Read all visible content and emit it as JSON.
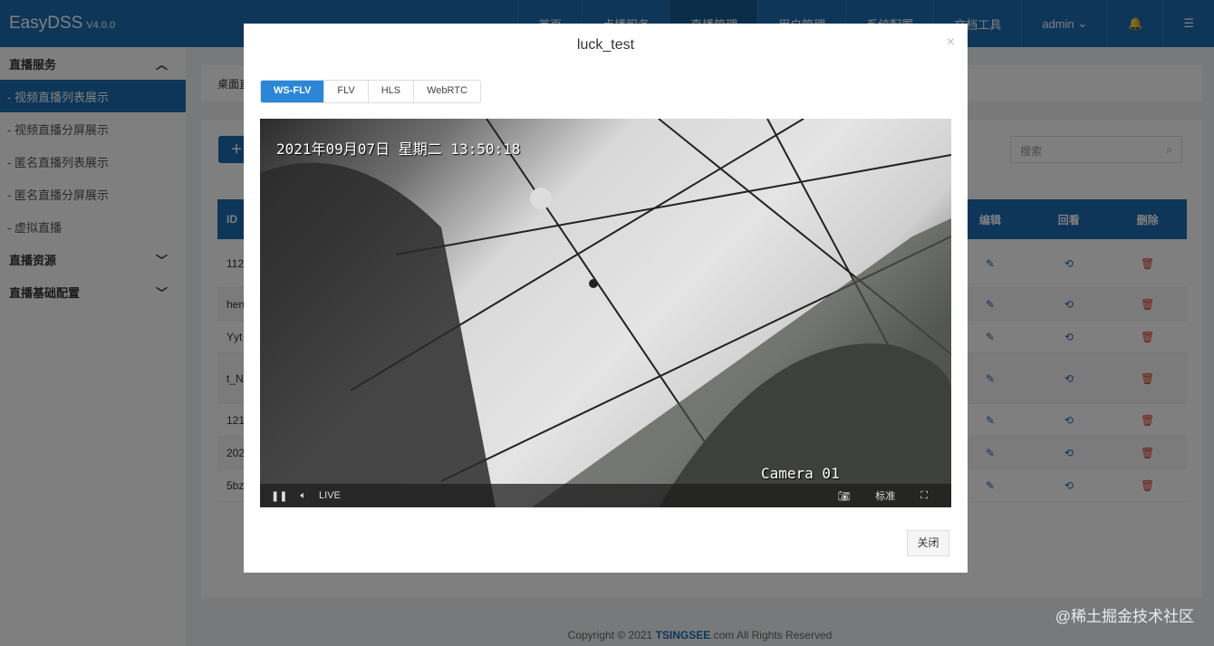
{
  "header": {
    "logo": "EasyDSS",
    "version": "V4.0.0",
    "nav": [
      "首页",
      "点播服务",
      "直播管理",
      "用户管理",
      "系统配置",
      "文档工具"
    ],
    "user": "admin"
  },
  "sidebar": {
    "groups": [
      {
        "label": "直播服务",
        "items": [
          "- 视频直播列表展示",
          "- 视频直播分屏展示",
          "- 匿名直播列表展示",
          "- 匿名直播分屏展示",
          "- 虚拟直播"
        ]
      },
      {
        "label": "直播资源"
      },
      {
        "label": "直播基础配置"
      }
    ]
  },
  "main": {
    "breadcrumb": "桌面直",
    "add": "+",
    "search_placeholder": "搜索",
    "columns": {
      "id": "ID",
      "edit": "编辑",
      "playback": "回看",
      "delete": "删除"
    },
    "rows": [
      "112",
      "hen",
      "Yyt",
      "t_N",
      "121",
      "202",
      "5bz"
    ]
  },
  "footer": {
    "copyright": "Copyright © 2021 ",
    "brand": "TSINGSEE",
    "rest": ".com All Rights Reserved"
  },
  "modal": {
    "title": "luck_test",
    "tabs": [
      "WS-FLV",
      "FLV",
      "HLS",
      "WebRTC"
    ],
    "active_tab": "WS-FLV",
    "osd_time": "2021年09月07日  星期二  13:50:18",
    "osd_camera": "Camera 01",
    "live": "LIVE",
    "quality": "标准",
    "close_label": "关闭",
    "close_x": "×"
  },
  "watermark": "@稀土掘金技术社区"
}
